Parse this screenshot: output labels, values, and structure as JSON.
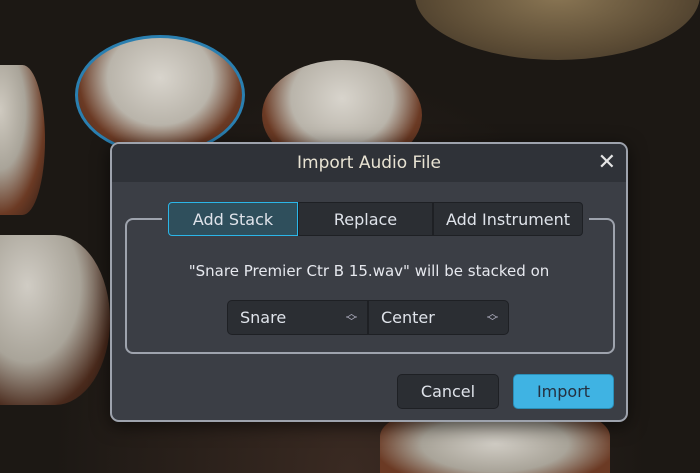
{
  "dialog": {
    "title": "Import Audio File",
    "close_icon": "close-icon",
    "tabs": [
      {
        "label": "Add Stack",
        "active": true
      },
      {
        "label": "Replace",
        "active": false
      },
      {
        "label": "Add Instrument",
        "active": false
      }
    ],
    "message": "\"Snare Premier Ctr B 15.wav\" will be stacked on",
    "selects": [
      {
        "value": "Snare"
      },
      {
        "value": "Center"
      }
    ],
    "cancel_label": "Cancel",
    "import_label": "Import",
    "accent_color": "#3fb3e3"
  }
}
